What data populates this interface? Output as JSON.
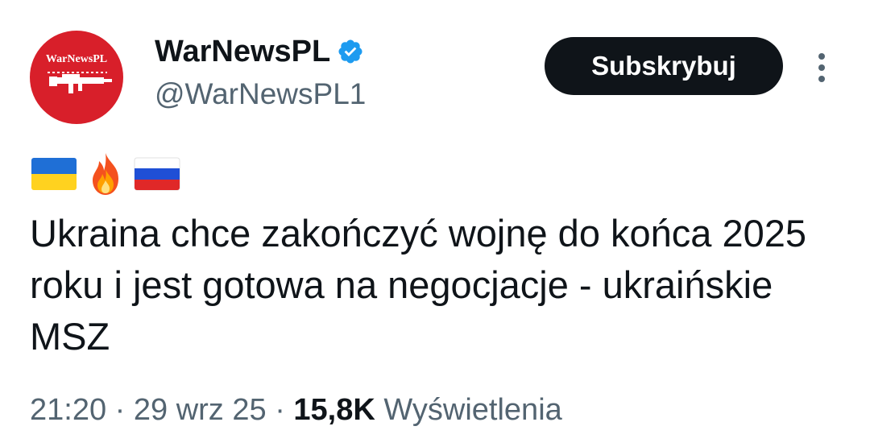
{
  "author": {
    "display_name": "WarNewsPL",
    "handle": "@WarNewsPL1",
    "avatar_text": "WarNewsPL",
    "verified": true,
    "avatar_color": "#d81f2a",
    "verified_color": "#1d9bf0"
  },
  "actions": {
    "subscribe_label": "Subskrybuj",
    "more_icon": "more-vertical-icon"
  },
  "tweet": {
    "emojis": [
      "ukraine-flag-icon",
      "fire-icon",
      "russia-flag-icon"
    ],
    "text": "Ukraina chce zakończyć wojnę do końca 2025 roku i jest gotowa na negocjacje - ukraińskie MSZ"
  },
  "meta": {
    "time": "21:20",
    "date": "29 wrz 25",
    "views_count": "15,8K",
    "views_label": "Wyświetlenia",
    "separator": "·"
  }
}
